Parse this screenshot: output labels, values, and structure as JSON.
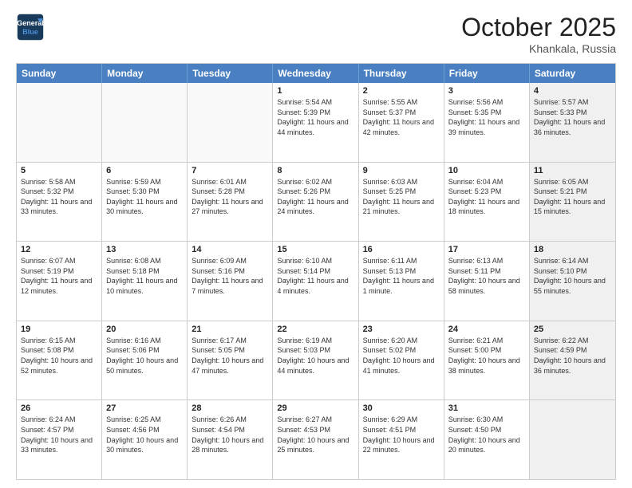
{
  "header": {
    "logo_line1": "General",
    "logo_line2": "Blue",
    "month": "October 2025",
    "location": "Khankala, Russia"
  },
  "days_of_week": [
    "Sunday",
    "Monday",
    "Tuesday",
    "Wednesday",
    "Thursday",
    "Friday",
    "Saturday"
  ],
  "weeks": [
    [
      {
        "day": "",
        "info": "",
        "empty": true
      },
      {
        "day": "",
        "info": "",
        "empty": true
      },
      {
        "day": "",
        "info": "",
        "empty": true
      },
      {
        "day": "1",
        "info": "Sunrise: 5:54 AM\nSunset: 5:39 PM\nDaylight: 11 hours and 44 minutes."
      },
      {
        "day": "2",
        "info": "Sunrise: 5:55 AM\nSunset: 5:37 PM\nDaylight: 11 hours and 42 minutes."
      },
      {
        "day": "3",
        "info": "Sunrise: 5:56 AM\nSunset: 5:35 PM\nDaylight: 11 hours and 39 minutes."
      },
      {
        "day": "4",
        "info": "Sunrise: 5:57 AM\nSunset: 5:33 PM\nDaylight: 11 hours and 36 minutes.",
        "shaded": true
      }
    ],
    [
      {
        "day": "5",
        "info": "Sunrise: 5:58 AM\nSunset: 5:32 PM\nDaylight: 11 hours and 33 minutes."
      },
      {
        "day": "6",
        "info": "Sunrise: 5:59 AM\nSunset: 5:30 PM\nDaylight: 11 hours and 30 minutes."
      },
      {
        "day": "7",
        "info": "Sunrise: 6:01 AM\nSunset: 5:28 PM\nDaylight: 11 hours and 27 minutes."
      },
      {
        "day": "8",
        "info": "Sunrise: 6:02 AM\nSunset: 5:26 PM\nDaylight: 11 hours and 24 minutes."
      },
      {
        "day": "9",
        "info": "Sunrise: 6:03 AM\nSunset: 5:25 PM\nDaylight: 11 hours and 21 minutes."
      },
      {
        "day": "10",
        "info": "Sunrise: 6:04 AM\nSunset: 5:23 PM\nDaylight: 11 hours and 18 minutes."
      },
      {
        "day": "11",
        "info": "Sunrise: 6:05 AM\nSunset: 5:21 PM\nDaylight: 11 hours and 15 minutes.",
        "shaded": true
      }
    ],
    [
      {
        "day": "12",
        "info": "Sunrise: 6:07 AM\nSunset: 5:19 PM\nDaylight: 11 hours and 12 minutes."
      },
      {
        "day": "13",
        "info": "Sunrise: 6:08 AM\nSunset: 5:18 PM\nDaylight: 11 hours and 10 minutes."
      },
      {
        "day": "14",
        "info": "Sunrise: 6:09 AM\nSunset: 5:16 PM\nDaylight: 11 hours and 7 minutes."
      },
      {
        "day": "15",
        "info": "Sunrise: 6:10 AM\nSunset: 5:14 PM\nDaylight: 11 hours and 4 minutes."
      },
      {
        "day": "16",
        "info": "Sunrise: 6:11 AM\nSunset: 5:13 PM\nDaylight: 11 hours and 1 minute."
      },
      {
        "day": "17",
        "info": "Sunrise: 6:13 AM\nSunset: 5:11 PM\nDaylight: 10 hours and 58 minutes."
      },
      {
        "day": "18",
        "info": "Sunrise: 6:14 AM\nSunset: 5:10 PM\nDaylight: 10 hours and 55 minutes.",
        "shaded": true
      }
    ],
    [
      {
        "day": "19",
        "info": "Sunrise: 6:15 AM\nSunset: 5:08 PM\nDaylight: 10 hours and 52 minutes."
      },
      {
        "day": "20",
        "info": "Sunrise: 6:16 AM\nSunset: 5:06 PM\nDaylight: 10 hours and 50 minutes."
      },
      {
        "day": "21",
        "info": "Sunrise: 6:17 AM\nSunset: 5:05 PM\nDaylight: 10 hours and 47 minutes."
      },
      {
        "day": "22",
        "info": "Sunrise: 6:19 AM\nSunset: 5:03 PM\nDaylight: 10 hours and 44 minutes."
      },
      {
        "day": "23",
        "info": "Sunrise: 6:20 AM\nSunset: 5:02 PM\nDaylight: 10 hours and 41 minutes."
      },
      {
        "day": "24",
        "info": "Sunrise: 6:21 AM\nSunset: 5:00 PM\nDaylight: 10 hours and 38 minutes."
      },
      {
        "day": "25",
        "info": "Sunrise: 6:22 AM\nSunset: 4:59 PM\nDaylight: 10 hours and 36 minutes.",
        "shaded": true
      }
    ],
    [
      {
        "day": "26",
        "info": "Sunrise: 6:24 AM\nSunset: 4:57 PM\nDaylight: 10 hours and 33 minutes."
      },
      {
        "day": "27",
        "info": "Sunrise: 6:25 AM\nSunset: 4:56 PM\nDaylight: 10 hours and 30 minutes."
      },
      {
        "day": "28",
        "info": "Sunrise: 6:26 AM\nSunset: 4:54 PM\nDaylight: 10 hours and 28 minutes."
      },
      {
        "day": "29",
        "info": "Sunrise: 6:27 AM\nSunset: 4:53 PM\nDaylight: 10 hours and 25 minutes."
      },
      {
        "day": "30",
        "info": "Sunrise: 6:29 AM\nSunset: 4:51 PM\nDaylight: 10 hours and 22 minutes."
      },
      {
        "day": "31",
        "info": "Sunrise: 6:30 AM\nSunset: 4:50 PM\nDaylight: 10 hours and 20 minutes."
      },
      {
        "day": "",
        "info": "",
        "empty": true,
        "shaded": true
      }
    ]
  ]
}
